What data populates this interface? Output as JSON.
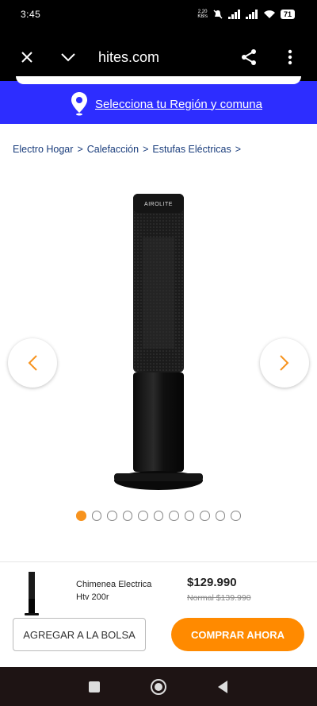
{
  "status_bar": {
    "time": "3:45",
    "data_speed_value": "2.20",
    "data_speed_unit": "KB/s",
    "battery": "71"
  },
  "browser": {
    "url": "hites.com",
    "icons": [
      "close-icon",
      "chevron-down-icon",
      "share-icon",
      "more-vert-icon"
    ]
  },
  "region": {
    "link_label": "Selecciona tu Región y comuna",
    "bar_color": "#2d2dff"
  },
  "breadcrumb": {
    "items": [
      "Electro Hogar",
      "Calefacción",
      "Estufas Eléctricas"
    ],
    "separator": ">"
  },
  "gallery": {
    "brand_on_product": "AIROLITE",
    "dots_total": 11,
    "active_dot": 0,
    "accent_color": "#f7931e"
  },
  "product": {
    "name": "Chimenea Electrica Htv 200r",
    "price": "$129.990",
    "old_price": "Normal $139.990"
  },
  "actions": {
    "add_to_bag": "AGREGAR A LA BOLSA",
    "buy_now": "COMPRAR AHORA",
    "buy_color": "#ff8a00"
  }
}
